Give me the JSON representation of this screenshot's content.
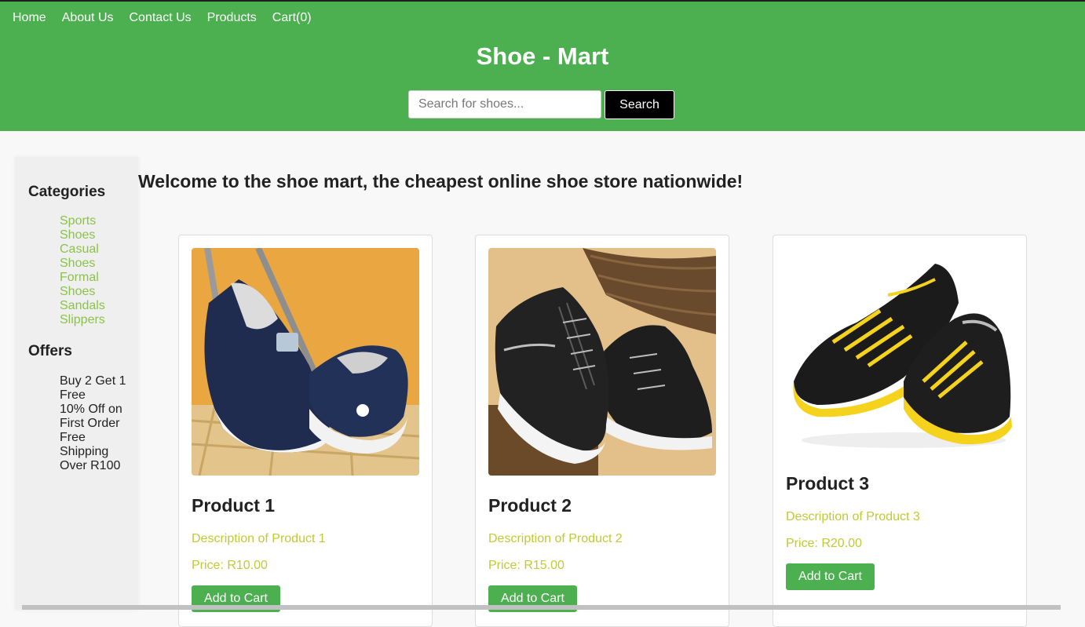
{
  "nav": {
    "items": [
      {
        "label": "Home"
      },
      {
        "label": "About Us"
      },
      {
        "label": "Contact Us"
      },
      {
        "label": "Products"
      },
      {
        "label": "Cart(0)"
      }
    ]
  },
  "header": {
    "title": "Shoe - Mart",
    "search": {
      "placeholder": "Search for shoes...",
      "value": "",
      "button_label": "Search"
    }
  },
  "sidebar": {
    "categories_title": "Categories",
    "categories": [
      "Sports Shoes",
      "Casual Shoes",
      "Formal Shoes",
      "Sandals",
      "Slippers"
    ],
    "offers_title": "Offers",
    "offers": [
      "Buy 2 Get 1 Free",
      "10% Off on First Order",
      "Free Shipping Over R100"
    ]
  },
  "main": {
    "welcome": "Welcome to the shoe mart, the cheapest online shoe store nationwide!",
    "products": [
      {
        "name": "Product 1",
        "description": "Description of Product 1",
        "price": "Price: R10.00",
        "button_label": "Add to Cart"
      },
      {
        "name": "Product 2",
        "description": "Description of Product 2",
        "price": "Price: R15.00",
        "button_label": "Add to Cart"
      },
      {
        "name": "Product 3",
        "description": "Description of Product 3",
        "price": "Price: R20.00",
        "button_label": "Add to Cart"
      }
    ]
  },
  "colors": {
    "header_green": "#4caf50",
    "category_link": "#8bc34a",
    "product_text": "#c0ca33",
    "search_button": "#000000"
  }
}
